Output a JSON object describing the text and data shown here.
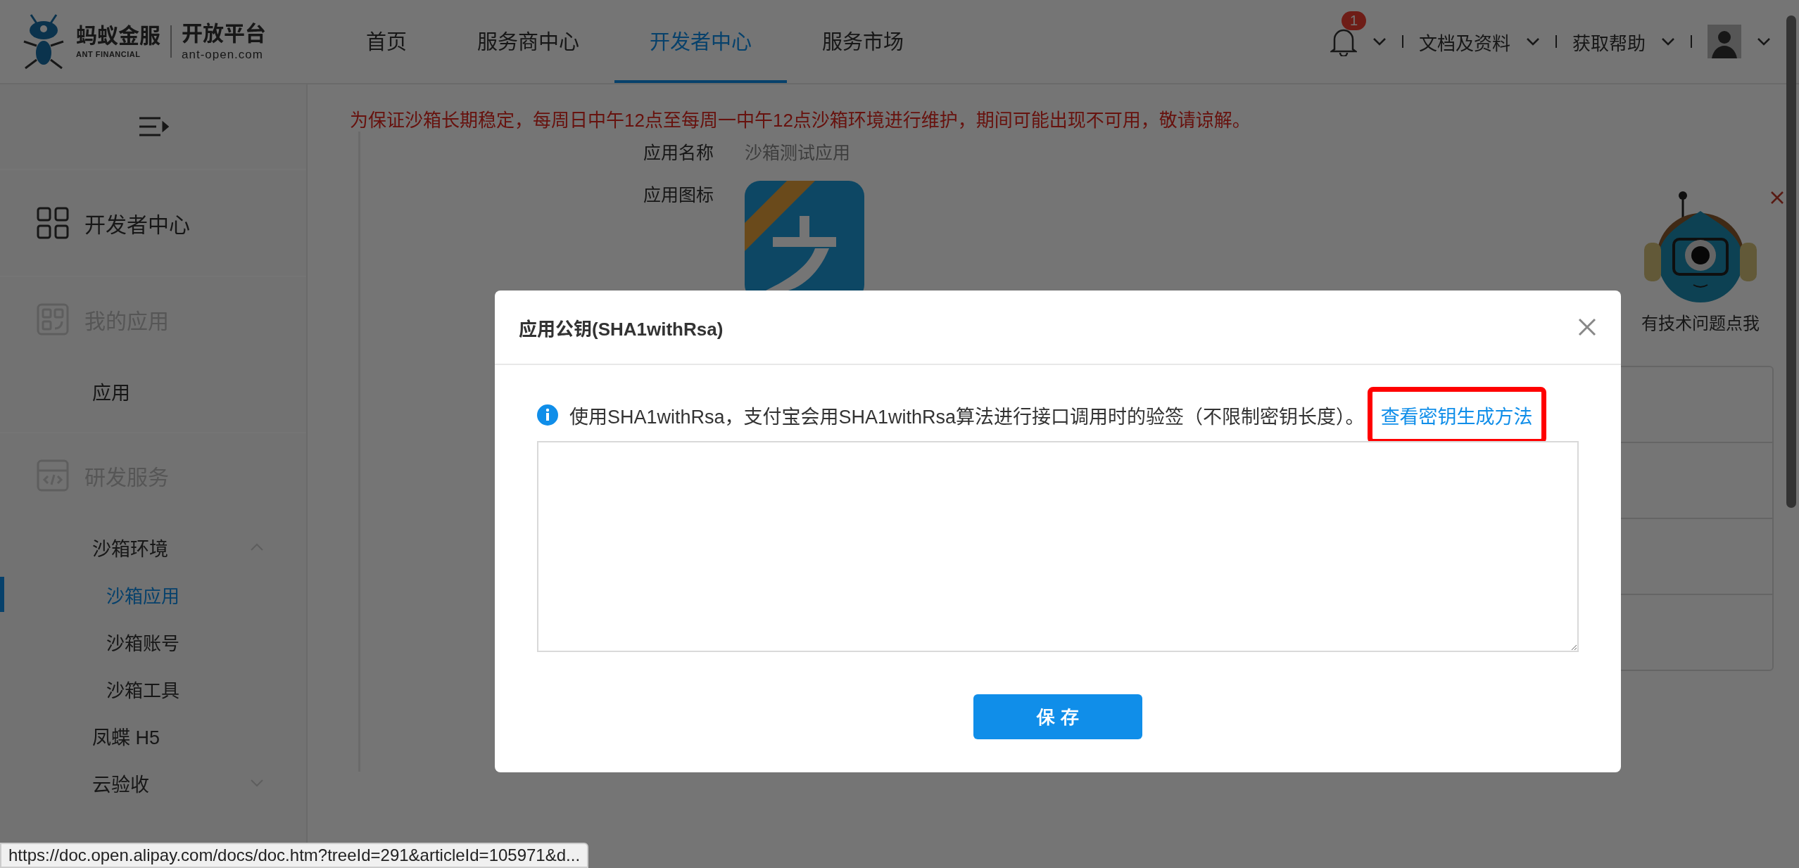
{
  "header": {
    "logo": {
      "brand": "蚂蚁金服",
      "brand_en": "ANT FINANCIAL",
      "product": "开放平台",
      "domain": "ant-open.com"
    },
    "nav": [
      {
        "label": "首页",
        "selected": false
      },
      {
        "label": "服务商中心",
        "selected": false
      },
      {
        "label": "开发者中心",
        "selected": true
      },
      {
        "label": "服务市场",
        "selected": false
      }
    ],
    "notifications": {
      "count": "1"
    },
    "menus": [
      {
        "label": "文档及资料"
      },
      {
        "label": "获取帮助"
      }
    ]
  },
  "sidebar": {
    "items": [
      {
        "label": "开发者中心",
        "disabled": false
      },
      {
        "label": "我的应用",
        "disabled": true,
        "children": [
          {
            "label": "应用",
            "selected": false
          }
        ]
      },
      {
        "label": "研发服务",
        "disabled": true,
        "children": [
          {
            "label": "沙箱环境",
            "selected": false,
            "expanded": true,
            "children": [
              {
                "label": "沙箱应用",
                "selected": true
              },
              {
                "label": "沙箱账号",
                "selected": false
              },
              {
                "label": "沙箱工具",
                "selected": false
              }
            ]
          },
          {
            "label": "凤蝶 H5",
            "selected": false
          },
          {
            "label": "云验收",
            "selected": false,
            "expanded": false
          }
        ]
      }
    ]
  },
  "main": {
    "notice": "为保证沙箱长期稳定，每周日中午12点至每周一中午12点沙箱环境进行维护，期间可能出现不可用，敬请谅解。",
    "fields": [
      {
        "kind": "text",
        "label": "应用名称",
        "value": "沙箱测试应用"
      },
      {
        "kind": "icon",
        "label": "应用图标"
      }
    ]
  },
  "helper": {
    "label": "有技术问题点我"
  },
  "modal": {
    "title": "应用公钥(SHA1withRsa)",
    "info": "使用SHA1withRsa，支付宝会用SHA1withRsa算法进行接口调用时的验签（不限制密钥长度）。",
    "link": {
      "label": "查看密钥生成方法",
      "highlighted": true
    },
    "button": "保 存"
  },
  "status_bar": {
    "url": "https://doc.open.alipay.com/docs/doc.htm?treeId=291&articleId=105971&d..."
  }
}
